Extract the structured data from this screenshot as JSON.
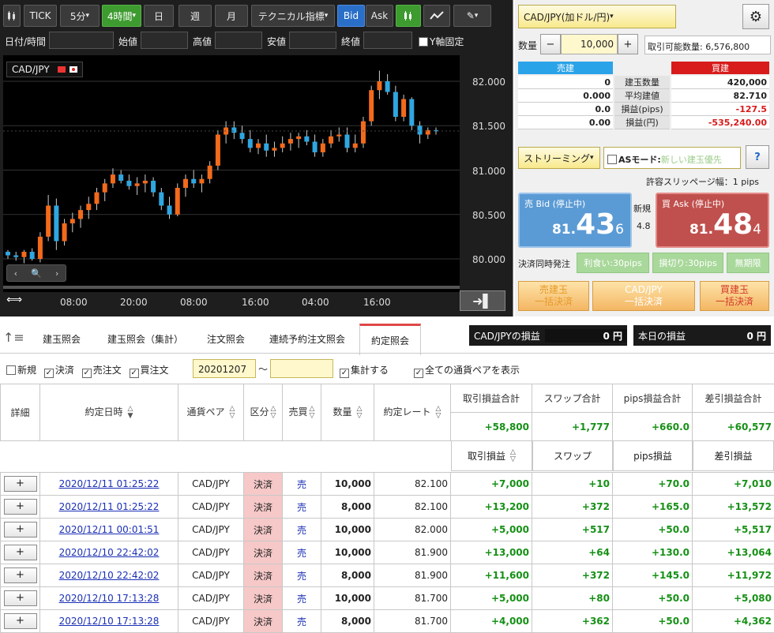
{
  "toolbar": {
    "tick": "TICK",
    "m5": "5分",
    "h4": "4時間",
    "day": "日",
    "week": "週",
    "month": "月",
    "technical": "テクニカル指標",
    "bid": "Bid",
    "ask": "Ask"
  },
  "filters": {
    "datetime": "日付/時間",
    "open": "始値",
    "high": "高値",
    "low": "安値",
    "close": "終値",
    "yfix": "Y軸固定"
  },
  "chart_data": {
    "type": "candlestick",
    "symbol": "CAD/JPY",
    "ylim": [
      79.9,
      82.2
    ],
    "y_ticks": [
      "82.000",
      "81.500",
      "81.000",
      "80.500",
      "80.000"
    ],
    "x_ticks": [
      "08:00",
      "20:00",
      "08:00",
      "16:00",
      "04:00",
      "16:00"
    ],
    "colors": {
      "up": "#f26a1b",
      "down": "#2fa6e0"
    },
    "candles": [
      [
        80.08,
        80.1,
        80.0,
        80.04
      ],
      [
        80.04,
        80.08,
        79.98,
        80.02
      ],
      [
        80.02,
        80.1,
        79.95,
        80.08
      ],
      [
        80.08,
        80.12,
        79.98,
        80.0
      ],
      [
        80.0,
        80.3,
        79.96,
        80.25
      ],
      [
        80.25,
        80.72,
        80.2,
        80.6
      ],
      [
        80.6,
        80.68,
        80.1,
        80.2
      ],
      [
        80.2,
        80.45,
        80.15,
        80.4
      ],
      [
        80.4,
        80.52,
        80.3,
        80.45
      ],
      [
        80.45,
        80.6,
        80.35,
        80.55
      ],
      [
        80.55,
        80.7,
        80.45,
        80.62
      ],
      [
        80.62,
        80.8,
        80.55,
        80.75
      ],
      [
        80.75,
        80.9,
        80.65,
        80.85
      ],
      [
        80.85,
        81.02,
        80.8,
        80.95
      ],
      [
        80.95,
        81.0,
        80.85,
        80.88
      ],
      [
        80.88,
        80.95,
        80.78,
        80.82
      ],
      [
        80.82,
        80.92,
        80.72,
        80.85
      ],
      [
        80.85,
        80.95,
        80.75,
        80.88
      ],
      [
        80.88,
        80.92,
        80.7,
        80.75
      ],
      [
        80.75,
        80.8,
        80.55,
        80.6
      ],
      [
        80.6,
        80.7,
        80.45,
        80.5
      ],
      [
        80.5,
        80.85,
        80.48,
        80.8
      ],
      [
        80.8,
        80.95,
        80.7,
        80.9
      ],
      [
        80.9,
        81.0,
        80.8,
        80.85
      ],
      [
        80.85,
        80.95,
        80.75,
        80.9
      ],
      [
        80.9,
        81.1,
        80.85,
        81.05
      ],
      [
        81.05,
        81.45,
        81.0,
        81.4
      ],
      [
        81.4,
        81.55,
        81.3,
        81.48
      ],
      [
        81.48,
        81.55,
        81.35,
        81.42
      ],
      [
        81.42,
        81.5,
        81.3,
        81.35
      ],
      [
        81.35,
        81.45,
        81.2,
        81.25
      ],
      [
        81.25,
        81.35,
        81.18,
        81.3
      ],
      [
        81.3,
        81.4,
        81.15,
        81.22
      ],
      [
        81.22,
        81.32,
        81.15,
        81.25
      ],
      [
        81.25,
        81.38,
        81.2,
        81.3
      ],
      [
        81.3,
        81.42,
        81.22,
        81.35
      ],
      [
        81.35,
        81.42,
        81.25,
        81.38
      ],
      [
        81.38,
        81.45,
        81.28,
        81.32
      ],
      [
        81.32,
        81.4,
        81.15,
        81.2
      ],
      [
        81.2,
        81.35,
        81.15,
        81.3
      ],
      [
        81.3,
        81.45,
        81.25,
        81.38
      ],
      [
        81.38,
        81.48,
        81.32,
        81.4
      ],
      [
        81.4,
        81.48,
        81.2,
        81.25
      ],
      [
        81.25,
        81.4,
        81.2,
        81.3
      ],
      [
        81.3,
        81.6,
        81.25,
        81.55
      ],
      [
        81.55,
        81.95,
        81.5,
        81.9
      ],
      [
        81.9,
        82.12,
        81.8,
        82.0
      ],
      [
        82.0,
        82.08,
        81.85,
        81.88
      ],
      [
        81.88,
        81.95,
        81.55,
        81.6
      ],
      [
        81.6,
        81.85,
        81.55,
        81.8
      ],
      [
        81.8,
        81.82,
        81.45,
        81.5
      ],
      [
        81.5,
        81.55,
        81.3,
        81.4
      ],
      [
        81.4,
        81.48,
        81.35,
        81.45
      ],
      [
        81.45,
        81.48,
        81.4,
        81.44
      ]
    ]
  },
  "order": {
    "pair": "CAD/JPY(加ドル/円)",
    "qty_label": "数量",
    "qty_value": "10,000",
    "minus": "−",
    "plus": "+",
    "available": "取引可能数量: 6,576,800",
    "sell_header": "売建",
    "buy_header": "買建",
    "rows": [
      {
        "label": "建玉数量",
        "sell": "0",
        "buy": "420,000"
      },
      {
        "label": "平均建値",
        "sell": "0.000",
        "buy": "82.710"
      },
      {
        "label": "損益(pips)",
        "sell": "0.0",
        "buy": "-127.5"
      },
      {
        "label": "損益(円)",
        "sell": "0.00",
        "buy": "-535,240.00"
      }
    ],
    "streaming": "ストリーミング",
    "as_mode": "ASモード:",
    "as_mode_value": "新しい建玉優先",
    "help": "?",
    "slippage": "許容スリッページ幅：1 pips",
    "bid_label": "売 Bid (停止中)",
    "bid_main": "81.43",
    "bid_small": "6",
    "ask_label": "買 Ask (停止中)",
    "ask_main": "81.48",
    "ask_small": "4",
    "new_label": "新規",
    "spread": "4.8",
    "settle_label": "決済同時発注",
    "take_profit": "利食い:30pips",
    "stop_loss": "損切り:30pips",
    "unlimited": "無期限",
    "bulk_sell_1": "売建玉",
    "bulk_sell_2": "一括決済",
    "bulk_pair_1": "CAD/JPY",
    "bulk_pair_2": "一括決済",
    "bulk_buy_1": "買建玉",
    "bulk_buy_2": "一括決済"
  },
  "tabs": [
    "建玉照会",
    "建玉照会（集計）",
    "注文照会",
    "連続予約注文照会",
    "約定照会"
  ],
  "summary": {
    "pair_pl_label": "CAD/JPYの損益",
    "pair_pl_value": "0 円",
    "today_pl_label": "本日の損益",
    "today_pl_value": "0 円"
  },
  "filter2": {
    "new": "新規",
    "settle": "決済",
    "sell": "売注文",
    "buy": "買注文",
    "date": "20201207",
    "tilde": "〜",
    "aggregate": "集計する",
    "all_pairs": "全ての通貨ペアを表示"
  },
  "table": {
    "headers": {
      "detail": "詳細",
      "datetime": "約定日時",
      "pair": "通貨ペア",
      "kubun": "区分",
      "baibai": "売買",
      "qty": "数量",
      "rate": "約定レート",
      "pl_total": "取引損益合計",
      "swap_total": "スワップ合計",
      "pips_total": "pips損益合計",
      "net_total": "差引損益合計",
      "pl": "取引損益",
      "swap": "スワップ",
      "pips": "pips損益",
      "net": "差引損益"
    },
    "totals": {
      "pl": "+58,800",
      "swap": "+1,777",
      "pips": "+660.0",
      "net": "+60,577"
    },
    "rows": [
      {
        "dt": "2020/12/11 01:25:22",
        "pair": "CAD/JPY",
        "kubun": "決済",
        "side": "売",
        "qty": "10,000",
        "rate": "82.100",
        "pl": "+7,000",
        "swap": "+10",
        "pips": "+70.0",
        "net": "+7,010"
      },
      {
        "dt": "2020/12/11 01:25:22",
        "pair": "CAD/JPY",
        "kubun": "決済",
        "side": "売",
        "qty": "8,000",
        "rate": "82.100",
        "pl": "+13,200",
        "swap": "+372",
        "pips": "+165.0",
        "net": "+13,572"
      },
      {
        "dt": "2020/12/11 00:01:51",
        "pair": "CAD/JPY",
        "kubun": "決済",
        "side": "売",
        "qty": "10,000",
        "rate": "82.000",
        "pl": "+5,000",
        "swap": "+517",
        "pips": "+50.0",
        "net": "+5,517"
      },
      {
        "dt": "2020/12/10 22:42:02",
        "pair": "CAD/JPY",
        "kubun": "決済",
        "side": "売",
        "qty": "10,000",
        "rate": "81.900",
        "pl": "+13,000",
        "swap": "+64",
        "pips": "+130.0",
        "net": "+13,064"
      },
      {
        "dt": "2020/12/10 22:42:02",
        "pair": "CAD/JPY",
        "kubun": "決済",
        "side": "売",
        "qty": "8,000",
        "rate": "81.900",
        "pl": "+11,600",
        "swap": "+372",
        "pips": "+145.0",
        "net": "+11,972"
      },
      {
        "dt": "2020/12/10 17:13:28",
        "pair": "CAD/JPY",
        "kubun": "決済",
        "side": "売",
        "qty": "10,000",
        "rate": "81.700",
        "pl": "+5,000",
        "swap": "+80",
        "pips": "+50.0",
        "net": "+5,080"
      },
      {
        "dt": "2020/12/10 17:13:28",
        "pair": "CAD/JPY",
        "kubun": "決済",
        "side": "売",
        "qty": "8,000",
        "rate": "81.700",
        "pl": "+4,000",
        "swap": "+362",
        "pips": "+50.0",
        "net": "+4,362"
      }
    ],
    "plus_label": "+"
  }
}
